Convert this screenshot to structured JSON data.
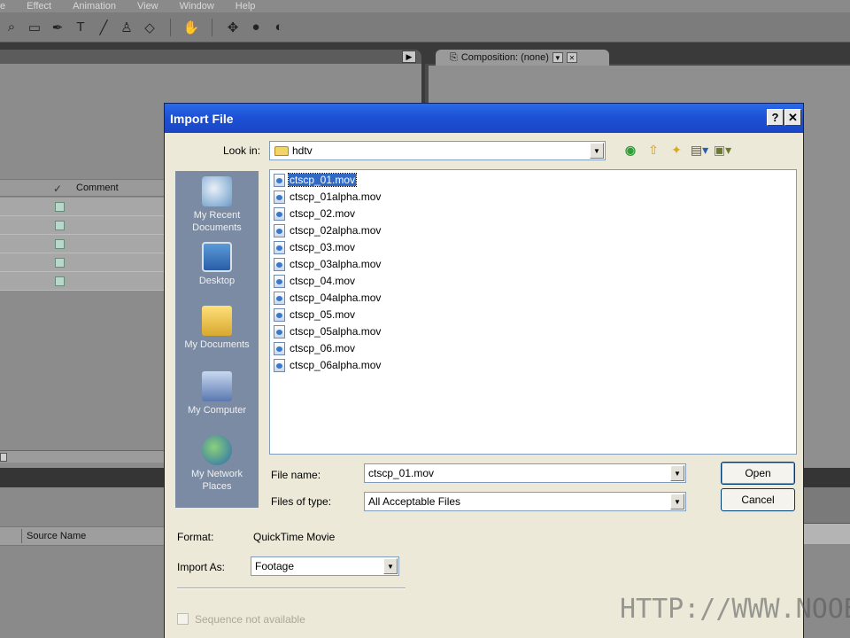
{
  "app": {
    "menu": [
      "e",
      "Effect",
      "Animation",
      "View",
      "Window",
      "Help"
    ],
    "project_panel": {
      "comment_header": "Comment",
      "rows": 5
    },
    "composition_tab": "Composition: (none)",
    "timeline": {
      "source_name_header": "Source Name"
    }
  },
  "dialog": {
    "title": "Import File",
    "help_glyph": "?",
    "close_glyph": "✕",
    "look_in_label": "Look in:",
    "look_in_value": "hdtv",
    "places": [
      {
        "label": "My Recent\nDocuments",
        "icon": "recent-documents-icon"
      },
      {
        "label": "Desktop",
        "icon": "desktop-icon"
      },
      {
        "label": "My Documents",
        "icon": "my-documents-icon"
      },
      {
        "label": "My Computer",
        "icon": "my-computer-icon"
      },
      {
        "label": "My Network\nPlaces",
        "icon": "network-places-icon"
      }
    ],
    "files": [
      "ctscp_01.mov",
      "ctscp_01alpha.mov",
      "ctscp_02.mov",
      "ctscp_02alpha.mov",
      "ctscp_03.mov",
      "ctscp_03alpha.mov",
      "ctscp_04.mov",
      "ctscp_04alpha.mov",
      "ctscp_05.mov",
      "ctscp_05alpha.mov",
      "ctscp_06.mov",
      "ctscp_06alpha.mov"
    ],
    "selected_file": "ctscp_01.mov",
    "file_name_label": "File name:",
    "file_name_value": "ctscp_01.mov",
    "files_of_type_label": "Files of type:",
    "files_of_type_value": "All Acceptable Files",
    "open_label": "Open",
    "cancel_label": "Cancel",
    "format_label": "Format:",
    "format_value": "QuickTime Movie",
    "import_as_label": "Import As:",
    "import_as_value": "Footage",
    "sequence_label": "Sequence not available"
  },
  "watermark": "HTTP://WWW.NOOBS"
}
